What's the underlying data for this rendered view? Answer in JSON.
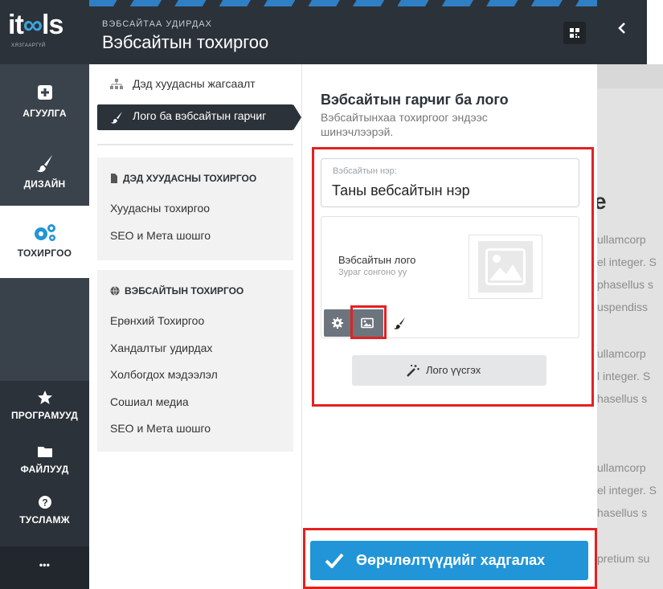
{
  "brand": {
    "name_part1": "it",
    "name_part2": "ls",
    "tagline": "ХЯЗГААРГҮЙ"
  },
  "rail": {
    "components": "АГУУЛГА",
    "design": "ДИЗАЙН",
    "settings": "ТОХИРГОО",
    "apps": "ПРОГРАМУУД",
    "files": "ФАЙЛУУД",
    "help": "ТУСЛАМЖ",
    "more": "•••"
  },
  "header": {
    "kicker": "ВЭБСАЙТАА УДИРДАХ",
    "title": "Вэбсайтын тохиргоо"
  },
  "submenu": {
    "sitemap": "Дэд хуудасны жагсаалт",
    "logo_title": "Лого ба вэбсайтын гарчиг",
    "page_settings": {
      "heading": "ДЭД ХУУДАСНЫ ТОХИРГОО",
      "items": [
        "Хуудасны тохиргоо",
        "SEO и Мета шошго"
      ]
    },
    "site_settings": {
      "heading": "ВЭБСАЙТЫН ТОХИРГОО",
      "items": [
        "Ерөнхий Тохиргоо",
        "Хандалтыг удирдах",
        "Холбогдох мэдээлэл",
        "Сошиал медиа",
        "SEO и Мета шошго"
      ]
    }
  },
  "panel": {
    "title": "Вэбсайтын гарчиг ба лого",
    "subtitle": "Вэбсайтынхаа тохиргоог эндээс шинэчлээрэй.",
    "name_field": {
      "label": "Вэбсайтын нэр:",
      "value": "Таны вебсайтын нэр"
    },
    "logo": {
      "title": "Вэбсайтын лого",
      "hint": "Зураг сонгоно уу"
    },
    "create_logo": "Лого үүсгэх",
    "save": "Өөрчлөлтүүдийг хадгалах"
  },
  "preview": {
    "heading_fragment": "e",
    "lines": [
      "ullamcorp",
      "el integer. S",
      "phasellus s",
      "uspendiss",
      "ullamcorp",
      "l integer. S",
      "hasellus s",
      "ullamcorp",
      "el integer. S",
      "hasellus s",
      "pretium su"
    ]
  },
  "colors": {
    "rail_bg": "#2c3239",
    "accent": "#2195d8",
    "highlight": "#e32121"
  }
}
